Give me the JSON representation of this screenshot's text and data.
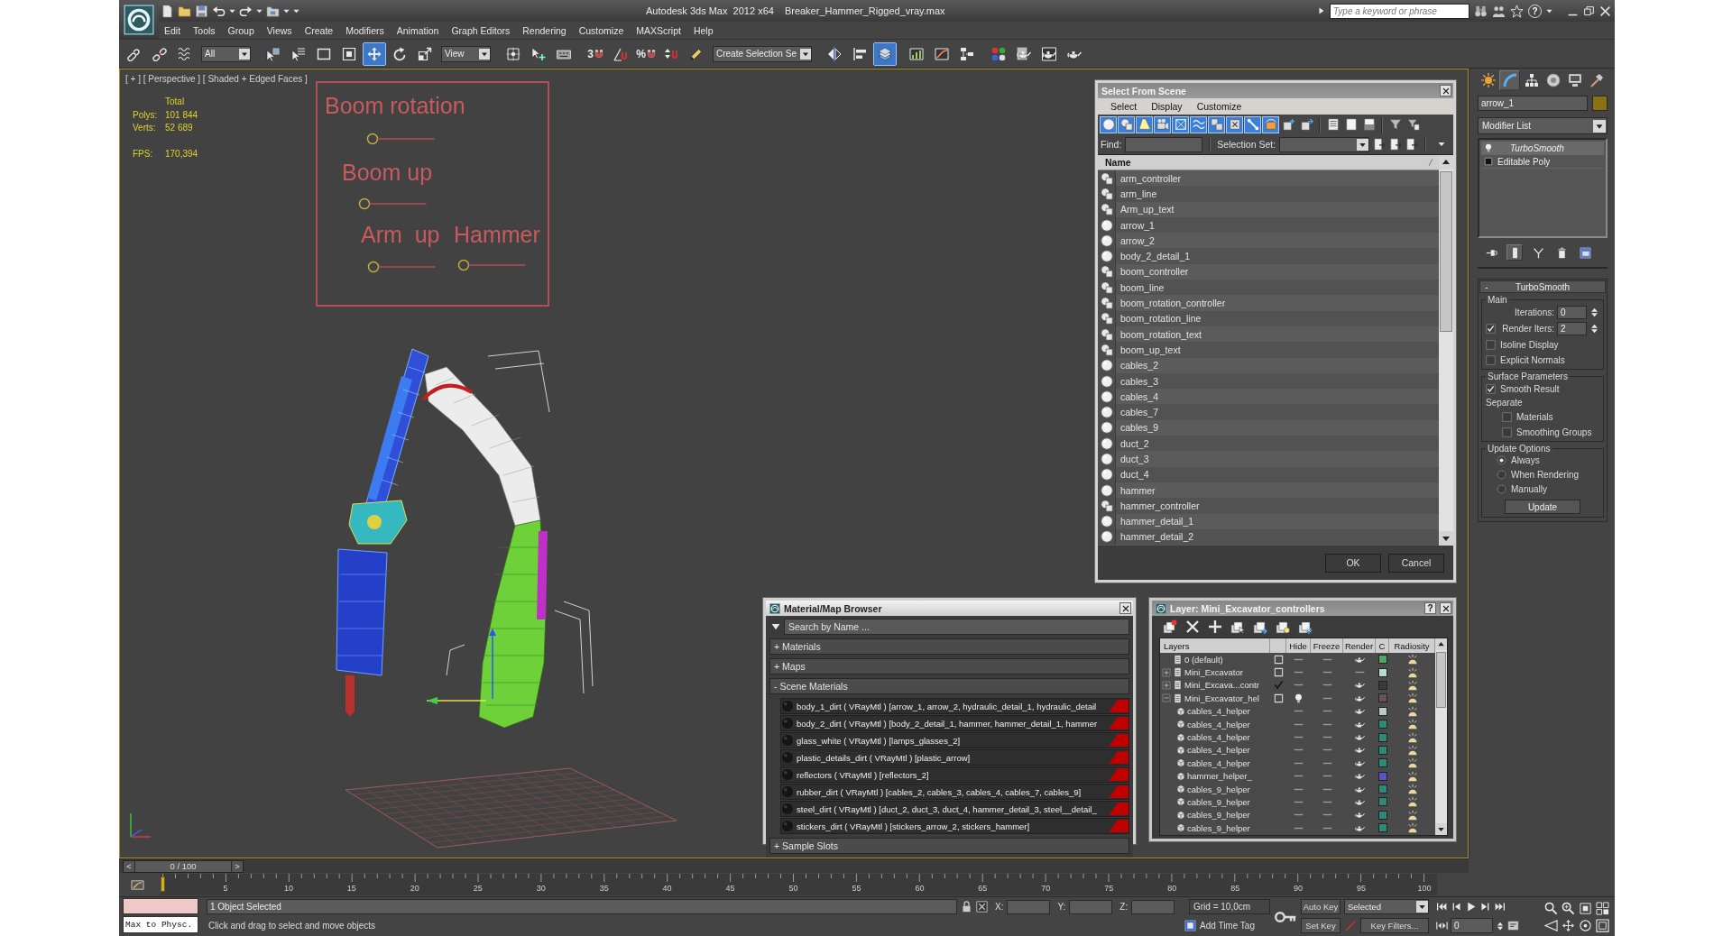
{
  "window": {
    "title": "Autodesk 3ds Max  2012 x64",
    "file_name": "Breaker_Hammer_Rigged_vray.max",
    "search": {
      "placeholder": "Type a keyword or phrase"
    },
    "help": "?"
  },
  "menu": [
    "Edit",
    "Tools",
    "Group",
    "Views",
    "Create",
    "Modifiers",
    "Animation",
    "Graph Editors",
    "Rendering",
    "Customize",
    "MAXScript",
    "Help"
  ],
  "main_toolbar": [
    {
      "kind": "link",
      "on": false
    },
    {
      "kind": "unlink",
      "on": false
    },
    {
      "kind": "bind",
      "on": false
    },
    {
      "kind": "dropdown",
      "value": "All"
    },
    {
      "kind": "select",
      "on": false
    },
    {
      "kind": "select_by_name",
      "on": false
    },
    {
      "kind": "region",
      "on": false
    },
    {
      "kind": "window_crossing",
      "on": false
    },
    {
      "kind": "move",
      "on": true
    },
    {
      "kind": "rotate",
      "on": false
    },
    {
      "kind": "scale",
      "on": false
    },
    {
      "kind": "dropdown",
      "value": "View"
    },
    {
      "kind": "pivot",
      "on": false
    },
    {
      "kind": "manipulate",
      "on": false
    },
    {
      "kind": "shortcut",
      "on": false
    },
    {
      "kind": "snap",
      "glyph": "3",
      "on": false
    },
    {
      "kind": "angle_snap",
      "on": false
    },
    {
      "kind": "percent_snap",
      "glyph": "%",
      "on": false
    },
    {
      "kind": "spinner_snap",
      "on": false
    },
    {
      "kind": "named_selection",
      "on": false
    },
    {
      "kind": "dropdown",
      "value": "Create Selection Se"
    },
    {
      "kind": "mirror",
      "on": false
    },
    {
      "kind": "align",
      "on": false
    },
    {
      "kind": "layers",
      "on": true
    },
    {
      "kind": "graph",
      "on": false
    },
    {
      "kind": "curve",
      "on": false
    },
    {
      "kind": "schematic",
      "on": false
    },
    {
      "kind": "material",
      "on": false
    },
    {
      "kind": "render_setup",
      "on": false
    },
    {
      "kind": "frame_window",
      "on": false
    },
    {
      "kind": "render",
      "on": false
    }
  ],
  "viewport": {
    "label": "[ + ] [ Perspective ] [ Shaded + Edged Faces ]",
    "stats": {
      "heading": "Total",
      "rows": [
        {
          "label": "Polys:",
          "value": "101 844"
        },
        {
          "label": "Verts:",
          "value": "52 689"
        },
        {
          "label": "FPS:",
          "value": "170,394"
        }
      ]
    },
    "control_board": [
      "Boom rotation",
      "Boom up",
      "Arm  up",
      "Hammer"
    ]
  },
  "select_from_scene": {
    "title": "Select From Scene",
    "menu": [
      "Select",
      "Display",
      "Customize"
    ],
    "filters": [
      {
        "kind": "geometry",
        "on": true
      },
      {
        "kind": "shapes",
        "on": true
      },
      {
        "kind": "lights",
        "on": true
      },
      {
        "kind": "cameras",
        "on": true
      },
      {
        "kind": "helpers",
        "on": true
      },
      {
        "kind": "space_warps",
        "on": true
      },
      {
        "kind": "groups",
        "on": true
      },
      {
        "kind": "xrefs",
        "on": true
      },
      {
        "kind": "bones",
        "on": true
      },
      {
        "kind": "containers",
        "on": true
      },
      {
        "kind": "add_object",
        "on": false
      },
      {
        "kind": "add_set",
        "on": false
      }
    ],
    "find_label": "Find:",
    "selection_set_label": "Selection Set:",
    "column": "Name",
    "rows": [
      {
        "name": "arm_controller",
        "kind": "shape",
        "selected": false
      },
      {
        "name": "arm_line",
        "kind": "shape",
        "selected": false
      },
      {
        "name": "Arm_up_text",
        "kind": "shape",
        "selected": false
      },
      {
        "name": "arrow_1",
        "kind": "geometry",
        "selected": false
      },
      {
        "name": "arrow_2",
        "kind": "geometry",
        "selected": false
      },
      {
        "name": "body_2_detail_1",
        "kind": "geometry",
        "selected": false
      },
      {
        "name": "boom_controller",
        "kind": "shape",
        "selected": false
      },
      {
        "name": "boom_line",
        "kind": "shape",
        "selected": false
      },
      {
        "name": "boom_rotation_controller",
        "kind": "shape",
        "selected": false
      },
      {
        "name": "boom_rotation_line",
        "kind": "shape",
        "selected": false
      },
      {
        "name": "boom_rotation_text",
        "kind": "shape",
        "selected": false
      },
      {
        "name": "boom_up_text",
        "kind": "shape",
        "selected": false
      },
      {
        "name": "cables_2",
        "kind": "geometry",
        "selected": false
      },
      {
        "name": "cables_3",
        "kind": "geometry",
        "selected": false
      },
      {
        "name": "cables_4",
        "kind": "geometry",
        "selected": false
      },
      {
        "name": "cables_7",
        "kind": "geometry",
        "selected": false
      },
      {
        "name": "cables_9",
        "kind": "geometry",
        "selected": false
      },
      {
        "name": "duct_2",
        "kind": "geometry",
        "selected": false
      },
      {
        "name": "duct_3",
        "kind": "geometry",
        "selected": false
      },
      {
        "name": "duct_4",
        "kind": "geometry",
        "selected": false
      },
      {
        "name": "hammer",
        "kind": "geometry",
        "selected": false
      },
      {
        "name": "hammer_controller",
        "kind": "shape",
        "selected": false
      },
      {
        "name": "hammer_detail_1",
        "kind": "geometry",
        "selected": false
      },
      {
        "name": "hammer_detail_2",
        "kind": "geometry",
        "selected": false
      }
    ],
    "buttons": [
      "OK",
      "Cancel"
    ]
  },
  "material_browser": {
    "title": "Material/Map Browser",
    "search": {
      "placeholder": "Search by Name ..."
    },
    "sections": [
      {
        "label": "+ Materials"
      },
      {
        "label": "+ Maps"
      },
      {
        "label": "- Scene Materials",
        "items": [
          "body_1_dirt ( VRayMtl ) [arrow_1, arrow_2, hydraulic_detail_1, hydraulic_detail",
          "body_2_dirt ( VRayMtl ) [body_2_detail_1, hammer, hammer_detail_1, hammer",
          "glass_white ( VRayMtl ) [lamps_glasses_2]",
          "plastic_details_dirt ( VRayMtl ) [plastic_arrow]",
          "reflectors ( VRayMtl ) [reflectors_2]",
          "rubber_dirt ( VRayMtl ) [cables_2, cables_3, cables_4, cables_7, cables_9]",
          "steel_dirt ( VRayMtl ) [duct_2, duct_3, duct_4, hammer_detail_3, steel__detail_",
          "stickers_dirt ( VRayMtl ) [stickers_arrow_2, stickers_hammer]"
        ]
      },
      {
        "label": "+ Sample Slots"
      }
    ]
  },
  "layer_manager": {
    "title": "Layer: Mini_Excavator_controllers",
    "help": "?",
    "columns": [
      "Layers",
      "Hide",
      "Freeze",
      "Render",
      "C",
      "Radiosity"
    ],
    "rows": [
      {
        "name": "0 (default)",
        "current": false,
        "hidden": false,
        "frozen": false,
        "render": true,
        "color": "#4ea860"
      },
      {
        "name": "Mini_Excavator",
        "expanded": false,
        "current": false,
        "hidden": false,
        "frozen": false,
        "render": false,
        "color": "#b4dcd2"
      },
      {
        "name": "Mini_Excava...contr",
        "expanded": false,
        "current": true,
        "hidden": false,
        "frozen": false,
        "render": true,
        "color": "#3a3a3a"
      },
      {
        "name": "Mini_Excavator_hel",
        "expanded": true,
        "current": false,
        "hidden": true,
        "frozen": false,
        "render": true,
        "color": "#6a5060",
        "children": [
          {
            "name": "cables_4_helper",
            "hidden": false,
            "frozen": false,
            "render": true,
            "color": "#b8ccc6"
          },
          {
            "name": "cables_4_helper",
            "hidden": false,
            "frozen": false,
            "render": true,
            "color": "#2e8a78"
          },
          {
            "name": "cables_4_helper",
            "hidden": false,
            "frozen": false,
            "render": true,
            "color": "#2e8a78"
          },
          {
            "name": "cables_4_helper",
            "hidden": false,
            "frozen": false,
            "render": true,
            "color": "#2e8a78"
          },
          {
            "name": "cables_4_helper",
            "hidden": false,
            "frozen": false,
            "render": true,
            "color": "#2e8a78"
          },
          {
            "name": "hammer_helper_",
            "hidden": false,
            "frozen": false,
            "render": true,
            "color": "#5a52c8"
          },
          {
            "name": "cables_9_helper",
            "hidden": false,
            "frozen": false,
            "render": true,
            "color": "#2e8a78"
          },
          {
            "name": "cables_9_helper",
            "hidden": false,
            "frozen": false,
            "render": true,
            "color": "#2e8a78"
          },
          {
            "name": "cables_9_helper",
            "hidden": false,
            "frozen": false,
            "render": true,
            "color": "#2e8a78"
          },
          {
            "name": "cables_9_helper",
            "hidden": false,
            "frozen": false,
            "render": true,
            "color": "#2e8a78"
          }
        ]
      }
    ]
  },
  "command_panel": {
    "tabs": [
      {
        "kind": "create",
        "selected": false
      },
      {
        "kind": "modify",
        "selected": true
      },
      {
        "kind": "hierarchy",
        "selected": false
      },
      {
        "kind": "motion",
        "selected": false
      },
      {
        "kind": "display",
        "selected": false
      },
      {
        "kind": "utilities",
        "selected": false
      }
    ],
    "object_name": "arrow_1",
    "modifier_list": "Modifier List",
    "stack": [
      {
        "kind": "modifier",
        "name": "TurboSmooth",
        "italic": true,
        "selected": true
      },
      {
        "kind": "base",
        "name": "Editable Poly",
        "italic": false,
        "selected": false
      }
    ],
    "stack_tools": [
      {
        "kind": "pin",
        "on": false
      },
      {
        "kind": "end_result",
        "on": true
      },
      {
        "kind": "make_unique",
        "on": false
      },
      {
        "kind": "remove",
        "on": false
      },
      {
        "kind": "configure",
        "on": false
      }
    ],
    "rollout": {
      "sign": "-",
      "title": "TurboSmooth",
      "groups": [
        {
          "title": "Main",
          "controls": [
            {
              "kind": "spinner",
              "label": "Iterations:",
              "value": "0"
            },
            {
              "kind": "check_spinner",
              "label": "Render Iters:",
              "value": "2",
              "checked": true
            },
            {
              "kind": "checkbox",
              "label": "Isoline Display",
              "checked": false
            },
            {
              "kind": "checkbox",
              "label": "Explicit Normals",
              "checked": false
            }
          ]
        },
        {
          "title": "Surface Parameters",
          "controls": [
            {
              "kind": "checkbox",
              "label": "Smooth Result",
              "checked": true
            },
            {
              "kind": "label",
              "label": "Separate",
              "children": [
                {
                  "kind": "checkbox",
                  "label": "Materials",
                  "checked": false
                },
                {
                  "kind": "checkbox",
                  "label": "Smoothing Groups",
                  "checked": false
                }
              ]
            }
          ]
        },
        {
          "title": "Update Options",
          "controls": [
            {
              "kind": "radio",
              "label": "Always",
              "selected": true
            },
            {
              "kind": "radio",
              "label": "When Rendering",
              "selected": false
            },
            {
              "kind": "radio",
              "label": "Manually",
              "selected": false
            },
            {
              "kind": "button",
              "label": "Update"
            }
          ]
        }
      ]
    }
  },
  "time_slider": {
    "previous": "<",
    "position": "0 / 100",
    "next": ">",
    "level": 0
  },
  "track_bar": {
    "ticks": [
      "5",
      "10",
      "15",
      "20",
      "25",
      "30",
      "35",
      "40",
      "45",
      "50",
      "55",
      "60",
      "65",
      "70",
      "75",
      "80",
      "85",
      "90",
      "95",
      "100"
    ]
  },
  "status_bar": {
    "listener": "Max to Physc.",
    "selection": "1 Object Selected",
    "prompt": "Click and drag to select and move objects",
    "coordinates": [
      "X:",
      "Y:",
      "Z:"
    ],
    "grid": "Grid = 10,0cm",
    "time_tag": "Add Time Tag",
    "auto_key": "Auto Key",
    "key_mode": "Selected",
    "set_key": "Set Key",
    "key_filters": "Key Filters...",
    "frame": "0"
  }
}
